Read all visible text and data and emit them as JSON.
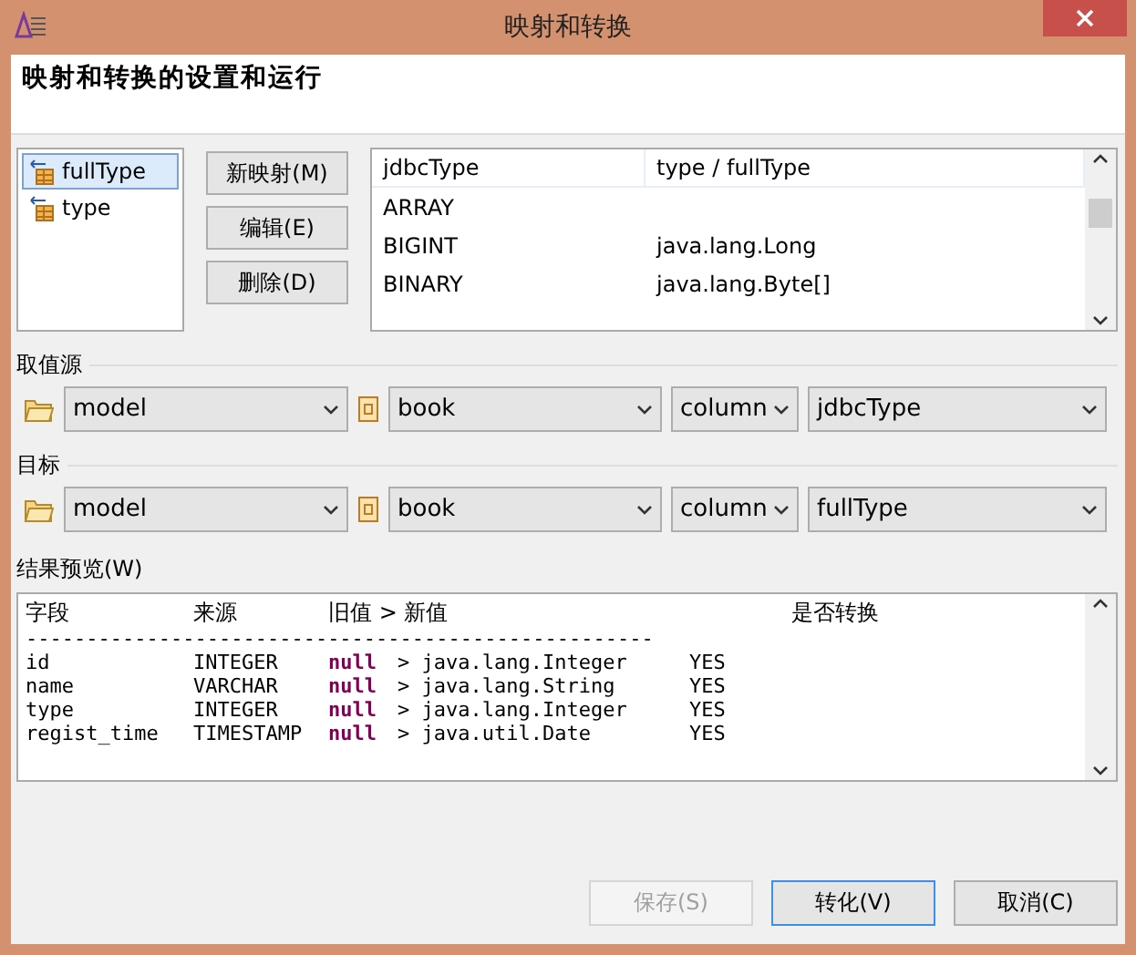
{
  "window": {
    "title": "映射和转换"
  },
  "header": {
    "title": "映射和转换的设置和运行"
  },
  "type_list": [
    {
      "label": "fullType",
      "selected": true
    },
    {
      "label": "type",
      "selected": false
    }
  ],
  "mapping_buttons": [
    "新映射(M)",
    "编辑(E)",
    "删除(D)"
  ],
  "mapping_table": {
    "columns": [
      "jdbcType",
      "type / fullType"
    ],
    "rows": [
      [
        "ARRAY",
        ""
      ],
      [
        "BIGINT",
        "java.lang.Long"
      ],
      [
        "BINARY",
        "java.lang.Byte[]"
      ]
    ]
  },
  "source": {
    "label": "取值源",
    "model": "model",
    "table": "book",
    "kind": "column",
    "field": "jdbcType"
  },
  "target": {
    "label": "目标",
    "model": "model",
    "table": "book",
    "kind": "column",
    "field": "fullType"
  },
  "preview": {
    "label": "结果预览(W)",
    "columns": [
      "字段",
      "来源",
      "旧值 > 新值",
      "是否转换"
    ],
    "separator": "----------------------------------------------------",
    "rows": [
      {
        "field": "id",
        "source": "INTEGER",
        "old": "null",
        "arrow": ">",
        "new": "java.lang.Integer",
        "convert": "YES"
      },
      {
        "field": "name",
        "source": "VARCHAR",
        "old": "null",
        "arrow": ">",
        "new": "java.lang.String",
        "convert": "YES"
      },
      {
        "field": "type",
        "source": "INTEGER",
        "old": "null",
        "arrow": ">",
        "new": "java.lang.Integer",
        "convert": "YES"
      },
      {
        "field": "regist_time",
        "source": "TIMESTAMP",
        "old": "null",
        "arrow": ">",
        "new": "java.util.Date",
        "convert": "YES"
      }
    ]
  },
  "buttons": [
    {
      "label": "保存(S)",
      "disabled": true,
      "default": false
    },
    {
      "label": "转化(V)",
      "disabled": false,
      "default": true
    },
    {
      "label": "取消(C)",
      "disabled": false,
      "default": false
    }
  ]
}
